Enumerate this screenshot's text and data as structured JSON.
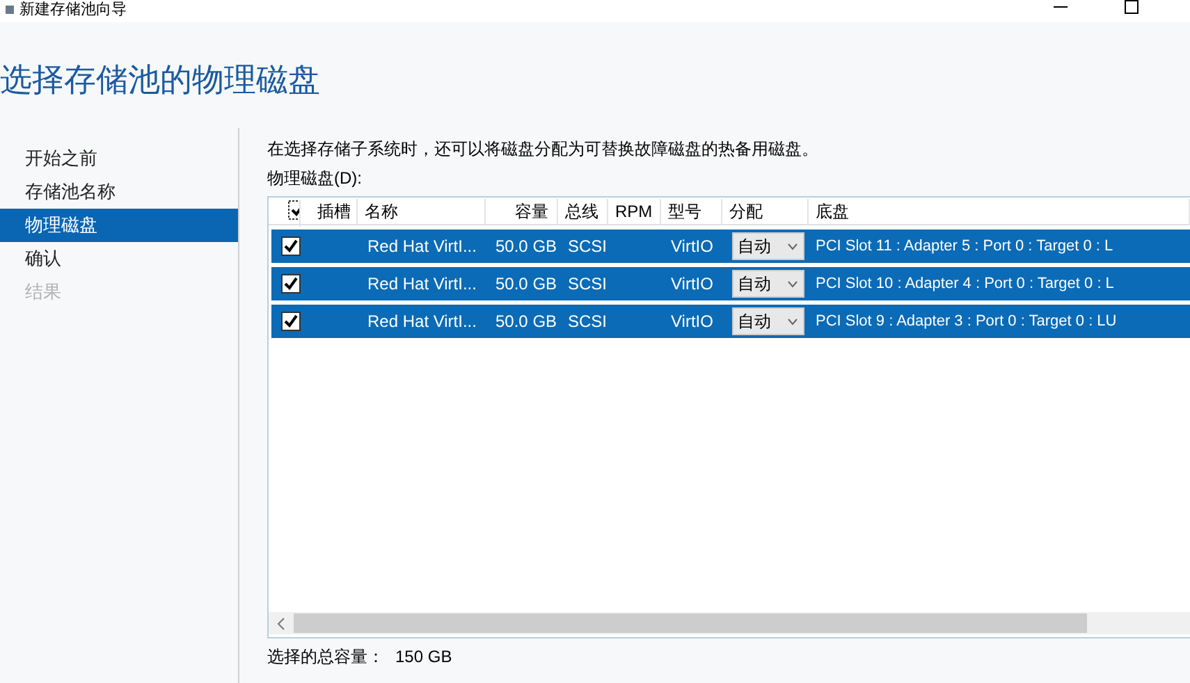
{
  "window": {
    "title": "新建存储池向导"
  },
  "heading": "选择存储池的物理磁盘",
  "sidebar": {
    "items": [
      {
        "label": "开始之前",
        "selected": false,
        "disabled": false
      },
      {
        "label": "存储池名称",
        "selected": false,
        "disabled": false
      },
      {
        "label": "物理磁盘",
        "selected": true,
        "disabled": false
      },
      {
        "label": "确认",
        "selected": false,
        "disabled": false
      },
      {
        "label": "结果",
        "selected": false,
        "disabled": true
      }
    ]
  },
  "description": "在选择存储子系统时，还可以将磁盘分配为可替换故障磁盘的热备用磁盘。",
  "disk_label": "物理磁盘(D):",
  "table": {
    "all_checked": true,
    "columns": [
      "插槽",
      "名称",
      "容量",
      "总线",
      "RPM",
      "型号",
      "分配",
      "底盘"
    ],
    "rows": [
      {
        "checked": true,
        "selected": true,
        "slot": "",
        "name": "Red Hat VirtI...",
        "capacity": "50.0 GB",
        "bus": "SCSI",
        "rpm": "",
        "model": "VirtIO",
        "allocation": "自动",
        "chassis": "PCI Slot 11 : Adapter 5 : Port 0 : Target 0 : L"
      },
      {
        "checked": true,
        "selected": true,
        "slot": "",
        "name": "Red Hat VirtI...",
        "capacity": "50.0 GB",
        "bus": "SCSI",
        "rpm": "",
        "model": "VirtIO",
        "allocation": "自动",
        "chassis": "PCI Slot 10 : Adapter 4 : Port 0 : Target 0 : L"
      },
      {
        "checked": true,
        "selected": true,
        "slot": "",
        "name": "Red Hat VirtI...",
        "capacity": "50.0 GB",
        "bus": "SCSI",
        "rpm": "",
        "model": "VirtIO",
        "allocation": "自动",
        "chassis": "PCI Slot 9 : Adapter 3 : Port 0 : Target 0 : LU"
      }
    ]
  },
  "total": {
    "label": "选择的总容量：",
    "value": "150 GB"
  }
}
